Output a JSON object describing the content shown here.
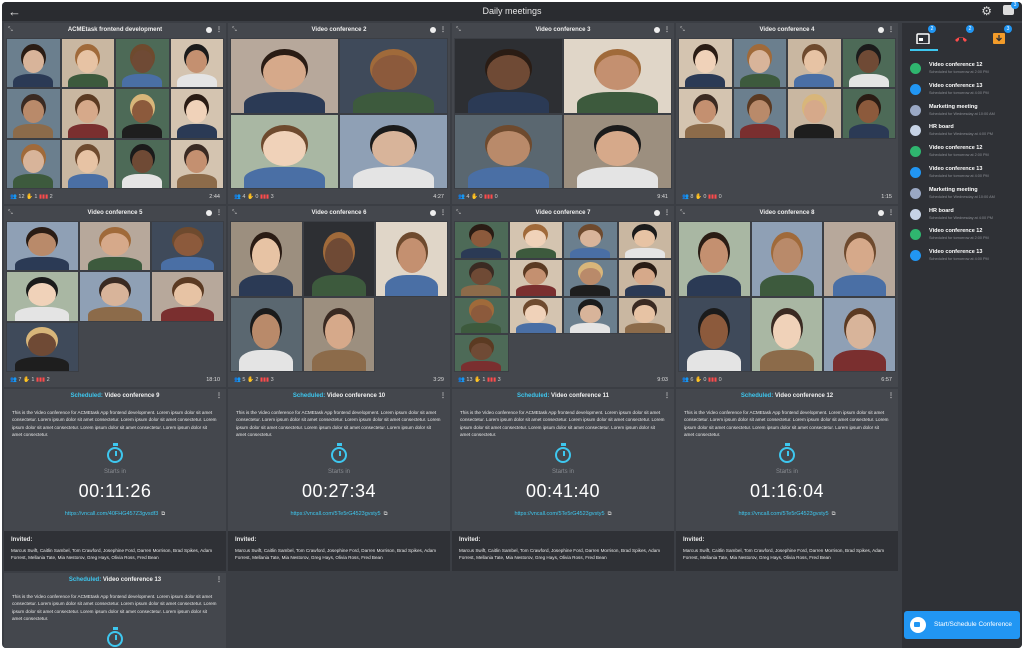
{
  "header": {
    "title": "Daily meetings",
    "back_icon": "arrow-left-icon",
    "settings_icon": "gear-icon",
    "chat_badge": "3"
  },
  "live_conferences": [
    {
      "title": "ACMEtask frontend development",
      "participants": "12",
      "hands": "1",
      "signal": "2",
      "duration": "2:44"
    },
    {
      "title": "Video conference 2",
      "participants": "4",
      "hands": "0",
      "signal": "3",
      "duration": "4:27"
    },
    {
      "title": "Video conference 3",
      "participants": "4",
      "hands": "0",
      "signal": "0",
      "duration": "9:41"
    },
    {
      "title": "Video conference 4",
      "participants": "8",
      "hands": "0",
      "signal": "0",
      "duration": "1:15"
    },
    {
      "title": "Video conference 5",
      "participants": "7",
      "hands": "1",
      "signal": "2",
      "duration": "18:10"
    },
    {
      "title": "Video conference 6",
      "participants": "5",
      "hands": "2",
      "signal": "3",
      "duration": "3:29"
    },
    {
      "title": "Video conference 7",
      "participants": "13",
      "hands": "1",
      "signal": "3",
      "duration": "9:03"
    },
    {
      "title": "Video conference 8",
      "participants": "6",
      "hands": "0",
      "signal": "0",
      "duration": "6:57"
    }
  ],
  "scheduled_prefix": "Scheduled:",
  "starts_in_label": "Starts in",
  "invited_label": "Invited:",
  "description": "This is the Video conference for ACMEtask App frontend development. Lorem ipsum dolor sit amet consectetur. Lorem ipsum dolor sit amet consectetur. Lorem ipsum dolor sit amet consectetur. Lorem ipsum dolor sit amet consectetur. Lorem ipsum dolor sit amet consectetur. Lorem ipsum dolor sit amet consectetur.",
  "invited_names": "Marcus Swift, Caitlin Sambel, Tom Crawford, Josephine Ford, Darren Morrison, Brad Spikes, Adam Forrest, Mellania Tate, Mia Nestorov, Greg Hays, Olivia Ross, Fred Bean",
  "scheduled": [
    {
      "title": "Video conference 9",
      "countdown": "00:11:26",
      "link": "https://vncall.com/40FHG457Z3gvsdf3"
    },
    {
      "title": "Video conference 10",
      "countdown": "00:27:34",
      "link": "https://vncall.com/5Te5rG4523gvsty5"
    },
    {
      "title": "Video conference 11",
      "countdown": "00:41:40",
      "link": "https://vncall.com/5Te5rG4523gvsty5"
    },
    {
      "title": "Video conference 12",
      "countdown": "01:16:04",
      "link": "https://vncall.com/5Te5rG4523gvsty5"
    },
    {
      "title": "Video conference 13",
      "countdown": "",
      "link": ""
    }
  ],
  "sidebar": {
    "tab_badges": [
      "2",
      "2",
      "3"
    ],
    "items": [
      {
        "title": "Video conference 12",
        "subtitle": "Scheduled for tomorrow at 2:00 PM",
        "kind": "video",
        "color": "#2fb66f"
      },
      {
        "title": "Video conference 13",
        "subtitle": "Scheduled for tomorrow at 4:00 PM",
        "kind": "phone",
        "color": "#2196f3"
      },
      {
        "title": "Marketing meeting",
        "subtitle": "Scheduled for Wednesday at 10:00 AM",
        "kind": "group",
        "color": "#9aa8c4"
      },
      {
        "title": "HR board",
        "subtitle": "Scheduled for Wednesday at 4:00 PM",
        "kind": "group",
        "color": "#c7d3e6"
      },
      {
        "title": "Video conference 12",
        "subtitle": "Scheduled for tomorrow at 2:00 PM",
        "kind": "video",
        "color": "#2fb66f"
      },
      {
        "title": "Video conference 13",
        "subtitle": "Scheduled for tomorrow at 4:00 PM",
        "kind": "phone",
        "color": "#2196f3"
      },
      {
        "title": "Marketing meeting",
        "subtitle": "Scheduled for Wednesday at 10:00 AM",
        "kind": "group",
        "color": "#9aa8c4"
      },
      {
        "title": "HR board",
        "subtitle": "Scheduled for Wednesday at 4:00 PM",
        "kind": "group",
        "color": "#c7d3e6"
      },
      {
        "title": "Video conference 12",
        "subtitle": "Scheduled for tomorrow at 2:00 PM",
        "kind": "video",
        "color": "#2fb66f"
      },
      {
        "title": "Video conference 13",
        "subtitle": "Scheduled for tomorrow at 4:00 PM",
        "kind": "phone",
        "color": "#2196f3"
      }
    ],
    "start_button": "Start/Schedule Conference"
  },
  "colors": {
    "accent": "#3ec7ef",
    "primary": "#2196f3",
    "background": "#3b3e44",
    "panel": "#44474d",
    "sidebar": "#2f3136",
    "alert": "#ff4b4b"
  }
}
